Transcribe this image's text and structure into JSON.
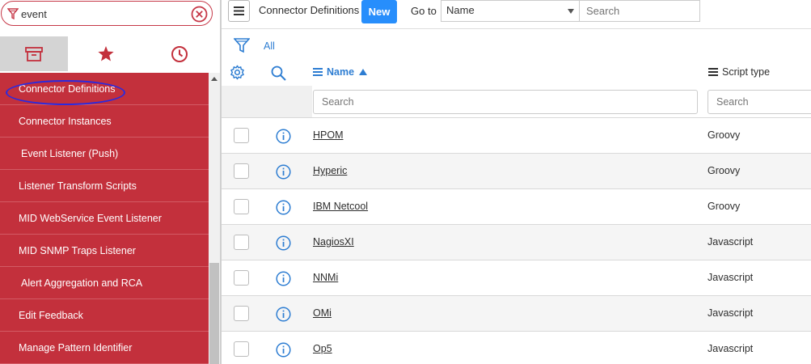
{
  "nav": {
    "filter_value": "event",
    "tabs": [
      {
        "name": "all-applications",
        "icon": "archive-icon"
      },
      {
        "name": "favorites",
        "icon": "star-icon"
      },
      {
        "name": "history",
        "icon": "clock-icon"
      }
    ],
    "items": [
      {
        "label": "Connector Definitions",
        "highlighted": true
      },
      {
        "label": "Connector Instances"
      },
      {
        "label": "Event Listener (Push)"
      },
      {
        "label": "Listener Transform Scripts"
      },
      {
        "label": "MID WebService Event Listener"
      },
      {
        "label": "MID SNMP Traps Listener"
      },
      {
        "label": "Alert Aggregation and RCA"
      },
      {
        "label": "Edit Feedback"
      },
      {
        "label": "Manage Pattern Identifier"
      }
    ],
    "colors": {
      "nav_bg": "#c3303c",
      "annotation": "#2a2adf"
    }
  },
  "header": {
    "title": "Connector Definitions",
    "new_label": "New",
    "goto_label": "Go to",
    "goto_field": "Name",
    "search_placeholder": "Search"
  },
  "filter": {
    "all_label": "All"
  },
  "columns": {
    "name": "Name",
    "script_type": "Script type",
    "name_search_placeholder": "Search",
    "type_search_placeholder": "Search"
  },
  "rows": [
    {
      "name": "HPOM",
      "script_type": "Groovy"
    },
    {
      "name": "Hyperic",
      "script_type": "Groovy"
    },
    {
      "name": "IBM Netcool",
      "script_type": "Groovy"
    },
    {
      "name": "NagiosXI",
      "script_type": "Javascript"
    },
    {
      "name": "NNMi",
      "script_type": "Javascript"
    },
    {
      "name": "OMi",
      "script_type": "Javascript"
    },
    {
      "name": "Op5",
      "script_type": "Javascript"
    }
  ],
  "colors": {
    "accent": "#278efc",
    "link": "#2d7dd2"
  }
}
